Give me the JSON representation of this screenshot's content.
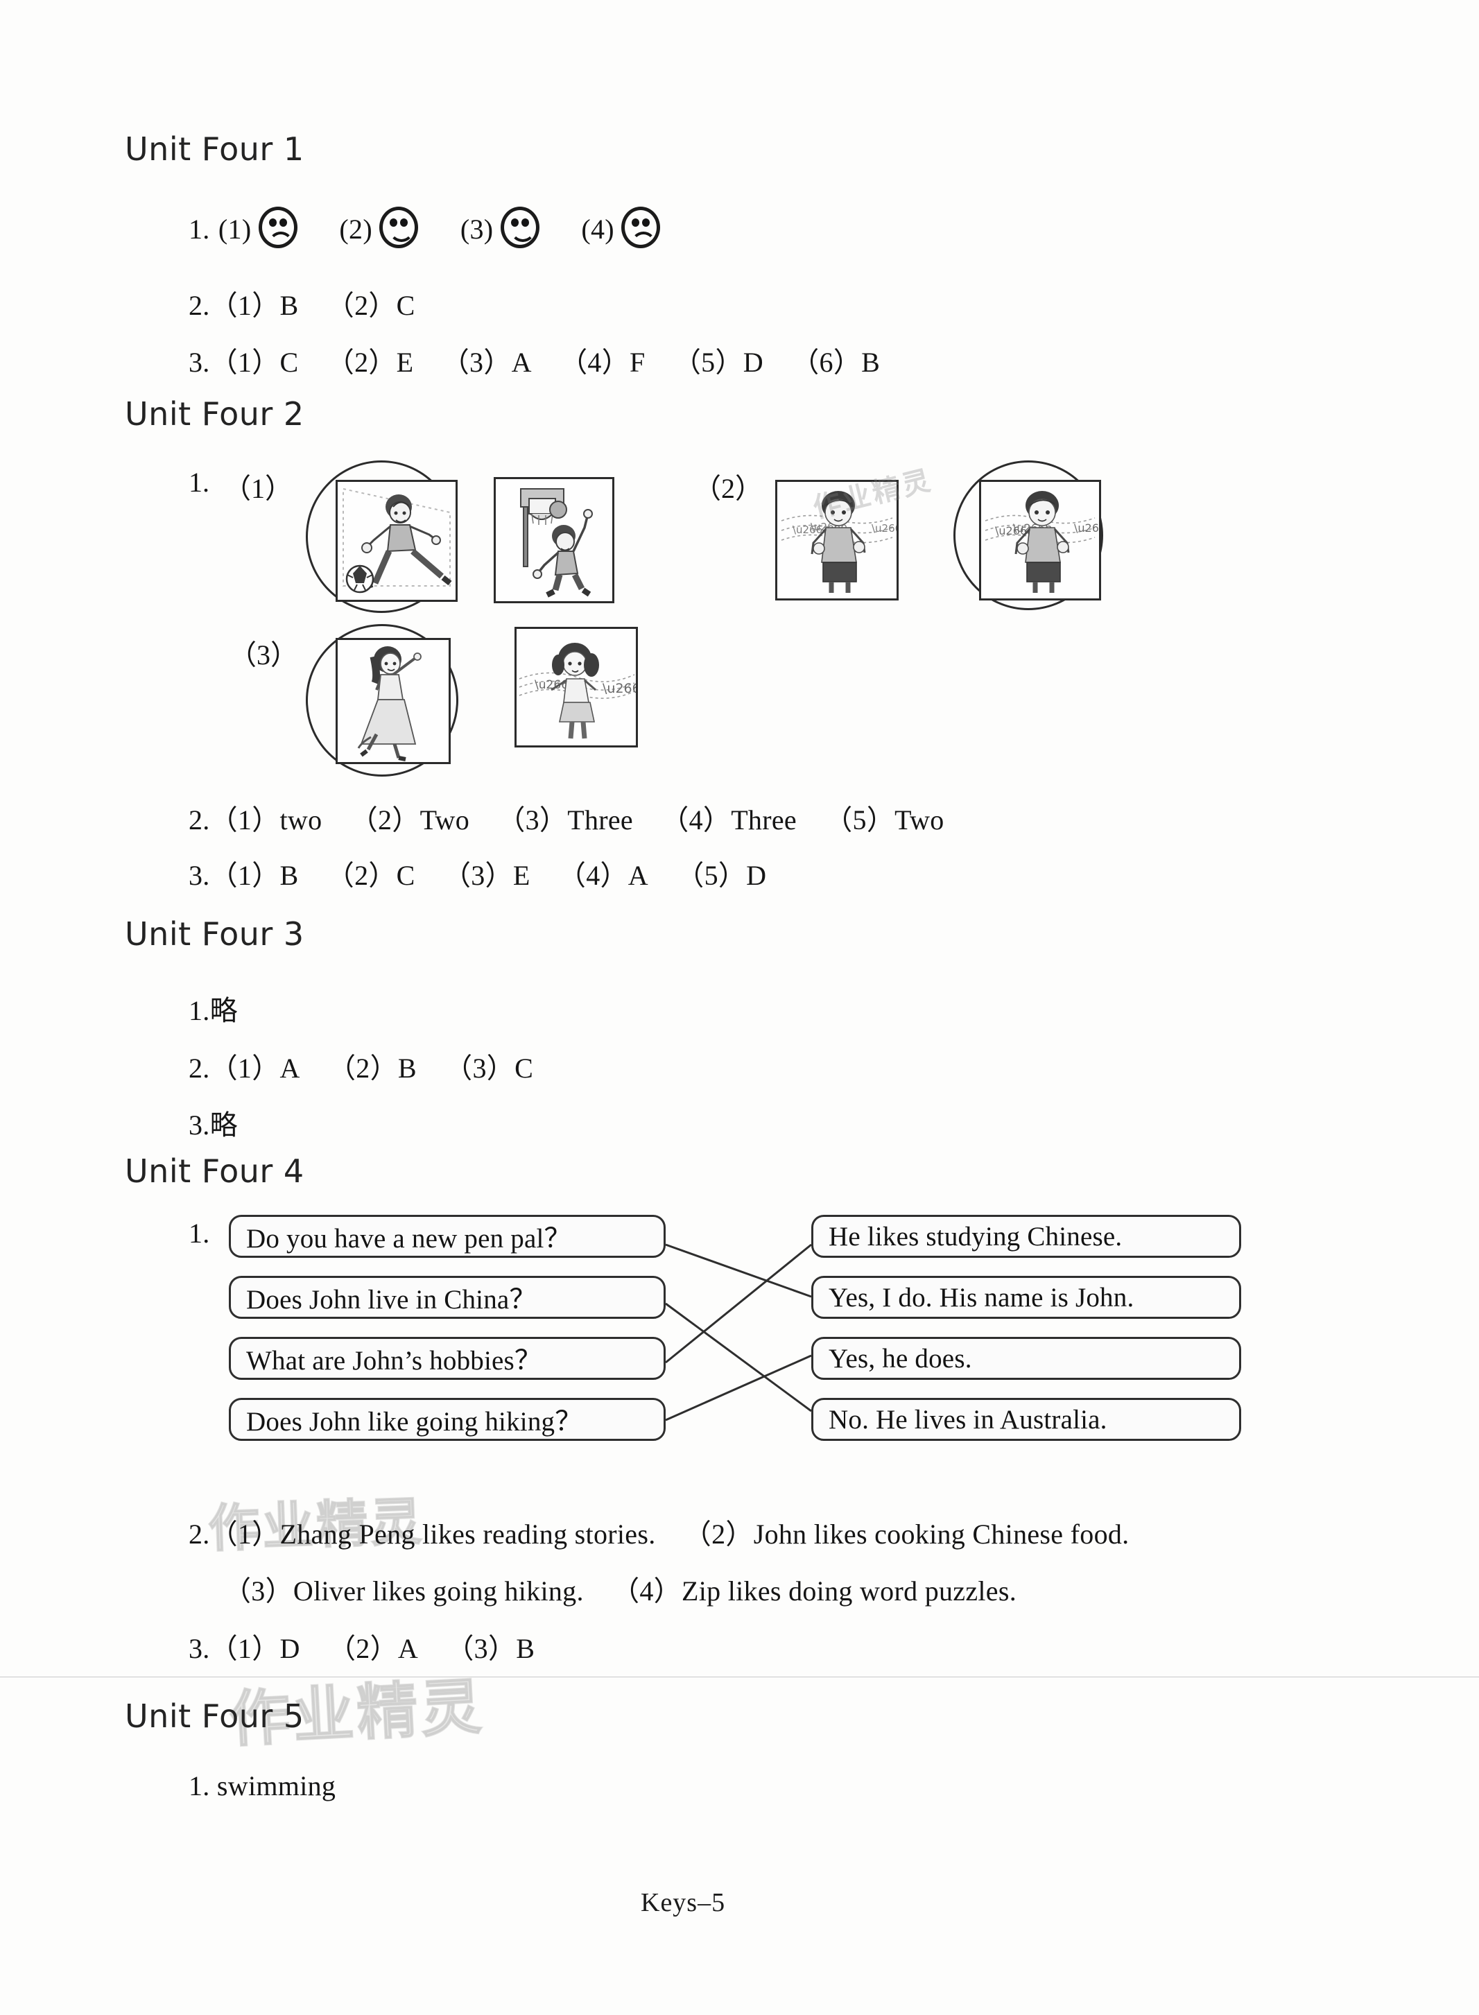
{
  "footer": {
    "label": "Keys–5"
  },
  "watermark": {
    "text": "作业精灵"
  },
  "units": {
    "u1": {
      "heading": "Unit Four 1",
      "q1": {
        "num": "1.",
        "items": [
          {
            "label": "(1)",
            "face": "sad"
          },
          {
            "label": "(2)",
            "face": "happy"
          },
          {
            "label": "(3)",
            "face": "happy"
          },
          {
            "label": "(4)",
            "face": "sad"
          }
        ]
      },
      "q2": {
        "text": "2.（1）B （2）C"
      },
      "q3": {
        "text": "3.（1）C （2）E （3）A （4）F （5）D （6）B"
      }
    },
    "u2": {
      "heading": "Unit Four 2",
      "q1": {
        "num": "1.",
        "rows": [
          {
            "label": "（1）",
            "pics": [
              {
                "art": "boy-playing-football",
                "circled": true
              },
              {
                "art": "boy-playing-basketball",
                "circled": false
              }
            ]
          },
          {
            "label": "（2）",
            "pics": [
              {
                "art": "boy-singing",
                "circled": false
              },
              {
                "art": "boy-singing",
                "circled": true
              }
            ]
          },
          {
            "label": "（3）",
            "pics": [
              {
                "art": "girl-dancing",
                "circled": true
              },
              {
                "art": "girl-singing",
                "circled": false
              }
            ]
          }
        ]
      },
      "q2": {
        "text": "2.（1）two （2）Two （3）Three （4）Three （5）Two"
      },
      "q3": {
        "text": "3.（1）B （2）C （3）E （4）A （5）D"
      }
    },
    "u3": {
      "heading": "Unit Four 3",
      "q1": {
        "text": "1.略"
      },
      "q2": {
        "text": "2.（1）A （2）B （3）C"
      },
      "q3": {
        "text": "3.略"
      }
    },
    "u4": {
      "heading": "Unit Four 4",
      "q1": {
        "num": "1.",
        "left": [
          "Do you have a new pen pal？",
          "Does John live in China？",
          "What are John’s hobbies？",
          "Does John like going hiking？"
        ],
        "right": [
          "He likes studying Chinese.",
          "Yes, I do. His name is John.",
          "Yes, he does.",
          "No. He lives in Australia."
        ],
        "matches": [
          {
            "from": 0,
            "to": 1
          },
          {
            "from": 1,
            "to": 3
          },
          {
            "from": 2,
            "to": 0
          },
          {
            "from": 3,
            "to": 2
          }
        ]
      },
      "q2": {
        "line1": "2.（1）Zhang Peng likes reading stories. （2）John likes cooking Chinese food.",
        "line2": "（3）Oliver likes going hiking. （4）Zip likes doing word puzzles."
      },
      "q3": {
        "text": "3.（1）D （2）A （3）B"
      }
    },
    "u5": {
      "heading": "Unit Four 5",
      "q1": {
        "text": "1. swimming"
      }
    }
  }
}
